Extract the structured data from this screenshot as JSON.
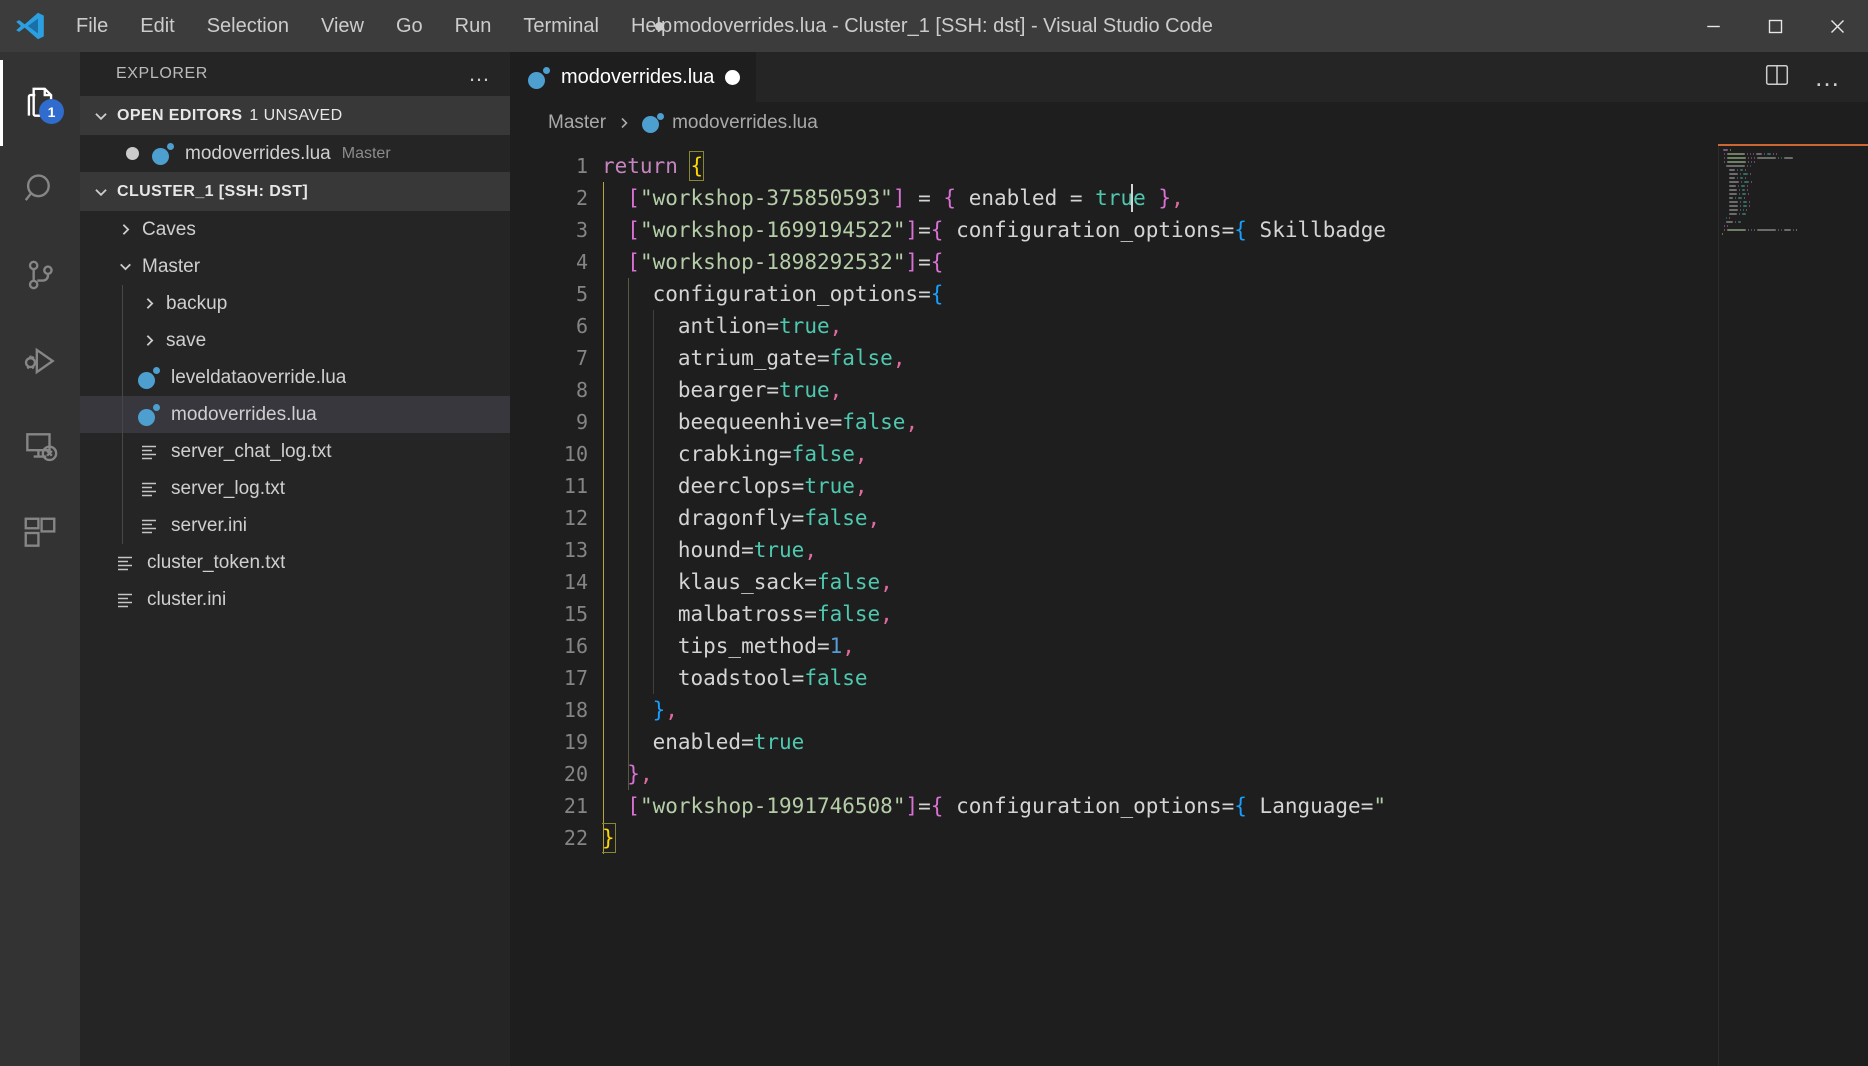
{
  "titlebar": {
    "menus": [
      "File",
      "Edit",
      "Selection",
      "View",
      "Go",
      "Run",
      "Terminal",
      "Help"
    ],
    "window_title": "modoverrides.lua - Cluster_1 [SSH: dst] - Visual Studio Code",
    "minimize_label": "Minimize",
    "maximize_label": "Maximize",
    "close_label": "Close"
  },
  "activitybar": {
    "items": [
      {
        "name": "explorer",
        "icon": "files-icon",
        "badge": "1",
        "active": true
      },
      {
        "name": "search",
        "icon": "search-icon",
        "badge": "",
        "active": false
      },
      {
        "name": "source-control",
        "icon": "source-control-icon",
        "badge": "",
        "active": false
      },
      {
        "name": "run-and-debug",
        "icon": "run-debug-icon",
        "badge": "",
        "active": false
      },
      {
        "name": "remote-explorer",
        "icon": "remote-explorer-icon",
        "badge": "",
        "active": false
      },
      {
        "name": "extensions",
        "icon": "extensions-icon",
        "badge": "",
        "active": false
      }
    ]
  },
  "sidebar": {
    "title": "EXPLORER",
    "more_actions": "…",
    "open_editors": {
      "label": "OPEN EDITORS",
      "badge": "1 UNSAVED",
      "items": [
        {
          "name": "modoverrides.lua",
          "detail": "Master",
          "icon": "lua-file-icon",
          "unsaved": true
        }
      ]
    },
    "workspace": {
      "label": "CLUSTER_1 [SSH: DST]",
      "tree": [
        {
          "name": "Caves",
          "type": "folder",
          "depth": 0,
          "expanded": false
        },
        {
          "name": "Master",
          "type": "folder",
          "depth": 0,
          "expanded": true
        },
        {
          "name": "backup",
          "type": "folder",
          "depth": 1,
          "expanded": false
        },
        {
          "name": "save",
          "type": "folder",
          "depth": 1,
          "expanded": false
        },
        {
          "name": "leveldataoverride.lua",
          "type": "lua",
          "depth": 1,
          "selected": false
        },
        {
          "name": "modoverrides.lua",
          "type": "lua",
          "depth": 1,
          "selected": true
        },
        {
          "name": "server_chat_log.txt",
          "type": "txt",
          "depth": 1,
          "selected": false
        },
        {
          "name": "server_log.txt",
          "type": "txt",
          "depth": 1,
          "selected": false
        },
        {
          "name": "server.ini",
          "type": "txt",
          "depth": 1,
          "selected": false
        },
        {
          "name": "cluster_token.txt",
          "type": "txt",
          "depth": 0,
          "selected": false
        },
        {
          "name": "cluster.ini",
          "type": "txt",
          "depth": 0,
          "selected": false
        }
      ]
    }
  },
  "editor": {
    "tab": {
      "label": "modoverrides.lua",
      "icon": "lua-file-icon",
      "dirty": true
    },
    "actions": {
      "split_editor": "split-editor-icon",
      "more": "…"
    },
    "breadcrumbs": [
      {
        "label": "Master",
        "icon": ""
      },
      {
        "label": "modoverrides.lua",
        "icon": "lua-file-icon"
      }
    ],
    "cursor_line": 2,
    "lines": [
      {
        "n": 1,
        "tokens": [
          {
            "t": "return",
            "c": "k-ret"
          },
          {
            "t": " ",
            "c": "k-plain"
          },
          {
            "t": "{",
            "c": "k-brace-y"
          }
        ]
      },
      {
        "n": 2,
        "tokens": [
          {
            "t": "  ",
            "c": "k-plain"
          },
          {
            "t": "[",
            "c": "k-brace-p"
          },
          {
            "t": "\"workshop-375850593\"",
            "c": "k-str"
          },
          {
            "t": "]",
            "c": "k-brace-p"
          },
          {
            "t": " = ",
            "c": "k-eq"
          },
          {
            "t": "{",
            "c": "k-brace-p"
          },
          {
            "t": " enabled ",
            "c": "k-plain"
          },
          {
            "t": "= ",
            "c": "k-eq"
          },
          {
            "t": "true",
            "c": "k-bool"
          },
          {
            "t": " ",
            "c": "k-plain"
          },
          {
            "t": "}",
            "c": "k-brace-p"
          },
          {
            "t": ",",
            "c": "k-brk"
          }
        ]
      },
      {
        "n": 3,
        "tokens": [
          {
            "t": "  ",
            "c": "k-plain"
          },
          {
            "t": "[",
            "c": "k-brace-p"
          },
          {
            "t": "\"workshop-1699194522\"",
            "c": "k-str"
          },
          {
            "t": "]",
            "c": "k-brace-p"
          },
          {
            "t": "=",
            "c": "k-eq"
          },
          {
            "t": "{",
            "c": "k-brace-p"
          },
          {
            "t": " configuration_options",
            "c": "k-plain"
          },
          {
            "t": "=",
            "c": "k-eq"
          },
          {
            "t": "{",
            "c": "k-brace-b"
          },
          {
            "t": " Skillbadge",
            "c": "k-plain"
          }
        ]
      },
      {
        "n": 4,
        "tokens": [
          {
            "t": "  ",
            "c": "k-plain"
          },
          {
            "t": "[",
            "c": "k-brace-p"
          },
          {
            "t": "\"workshop-1898292532\"",
            "c": "k-str"
          },
          {
            "t": "]",
            "c": "k-brace-p"
          },
          {
            "t": "=",
            "c": "k-eq"
          },
          {
            "t": "{",
            "c": "k-brace-p"
          }
        ]
      },
      {
        "n": 5,
        "tokens": [
          {
            "t": "    configuration_options",
            "c": "k-plain"
          },
          {
            "t": "=",
            "c": "k-eq"
          },
          {
            "t": "{",
            "c": "k-brace-b"
          }
        ]
      },
      {
        "n": 6,
        "tokens": [
          {
            "t": "      antlion",
            "c": "k-plain"
          },
          {
            "t": "=",
            "c": "k-eq"
          },
          {
            "t": "true",
            "c": "k-bool"
          },
          {
            "t": ",",
            "c": "k-brk"
          }
        ]
      },
      {
        "n": 7,
        "tokens": [
          {
            "t": "      atrium_gate",
            "c": "k-plain"
          },
          {
            "t": "=",
            "c": "k-eq"
          },
          {
            "t": "false",
            "c": "k-bool"
          },
          {
            "t": ",",
            "c": "k-brk"
          }
        ]
      },
      {
        "n": 8,
        "tokens": [
          {
            "t": "      bearger",
            "c": "k-plain"
          },
          {
            "t": "=",
            "c": "k-eq"
          },
          {
            "t": "true",
            "c": "k-bool"
          },
          {
            "t": ",",
            "c": "k-brk"
          }
        ]
      },
      {
        "n": 9,
        "tokens": [
          {
            "t": "      beequeenhive",
            "c": "k-plain"
          },
          {
            "t": "=",
            "c": "k-eq"
          },
          {
            "t": "false",
            "c": "k-bool"
          },
          {
            "t": ",",
            "c": "k-brk"
          }
        ]
      },
      {
        "n": 10,
        "tokens": [
          {
            "t": "      crabking",
            "c": "k-plain"
          },
          {
            "t": "=",
            "c": "k-eq"
          },
          {
            "t": "false",
            "c": "k-bool"
          },
          {
            "t": ",",
            "c": "k-brk"
          }
        ]
      },
      {
        "n": 11,
        "tokens": [
          {
            "t": "      deerclops",
            "c": "k-plain"
          },
          {
            "t": "=",
            "c": "k-eq"
          },
          {
            "t": "true",
            "c": "k-bool"
          },
          {
            "t": ",",
            "c": "k-brk"
          }
        ]
      },
      {
        "n": 12,
        "tokens": [
          {
            "t": "      dragonfly",
            "c": "k-plain"
          },
          {
            "t": "=",
            "c": "k-eq"
          },
          {
            "t": "false",
            "c": "k-bool"
          },
          {
            "t": ",",
            "c": "k-brk"
          }
        ]
      },
      {
        "n": 13,
        "tokens": [
          {
            "t": "      hound",
            "c": "k-plain"
          },
          {
            "t": "=",
            "c": "k-eq"
          },
          {
            "t": "true",
            "c": "k-bool"
          },
          {
            "t": ",",
            "c": "k-brk"
          }
        ]
      },
      {
        "n": 14,
        "tokens": [
          {
            "t": "      klaus_sack",
            "c": "k-plain"
          },
          {
            "t": "=",
            "c": "k-eq"
          },
          {
            "t": "false",
            "c": "k-bool"
          },
          {
            "t": ",",
            "c": "k-brk"
          }
        ]
      },
      {
        "n": 15,
        "tokens": [
          {
            "t": "      malbatross",
            "c": "k-plain"
          },
          {
            "t": "=",
            "c": "k-eq"
          },
          {
            "t": "false",
            "c": "k-bool"
          },
          {
            "t": ",",
            "c": "k-brk"
          }
        ]
      },
      {
        "n": 16,
        "tokens": [
          {
            "t": "      tips_method",
            "c": "k-plain"
          },
          {
            "t": "=",
            "c": "k-eq"
          },
          {
            "t": "1",
            "c": "k-num"
          },
          {
            "t": ",",
            "c": "k-brk"
          }
        ]
      },
      {
        "n": 17,
        "tokens": [
          {
            "t": "      toadstool",
            "c": "k-plain"
          },
          {
            "t": "=",
            "c": "k-eq"
          },
          {
            "t": "false",
            "c": "k-bool"
          }
        ]
      },
      {
        "n": 18,
        "tokens": [
          {
            "t": "    ",
            "c": "k-plain"
          },
          {
            "t": "}",
            "c": "k-brace-b"
          },
          {
            "t": ",",
            "c": "k-brk"
          }
        ]
      },
      {
        "n": 19,
        "tokens": [
          {
            "t": "    enabled",
            "c": "k-plain"
          },
          {
            "t": "=",
            "c": "k-eq"
          },
          {
            "t": "true",
            "c": "k-bool"
          }
        ]
      },
      {
        "n": 20,
        "tokens": [
          {
            "t": "  ",
            "c": "k-plain"
          },
          {
            "t": "}",
            "c": "k-brace-p"
          },
          {
            "t": ",",
            "c": "k-brk"
          }
        ]
      },
      {
        "n": 21,
        "tokens": [
          {
            "t": "  ",
            "c": "k-plain"
          },
          {
            "t": "[",
            "c": "k-brace-p"
          },
          {
            "t": "\"workshop-1991746508\"",
            "c": "k-str"
          },
          {
            "t": "]",
            "c": "k-brace-p"
          },
          {
            "t": "=",
            "c": "k-eq"
          },
          {
            "t": "{",
            "c": "k-brace-p"
          },
          {
            "t": " configuration_options",
            "c": "k-plain"
          },
          {
            "t": "=",
            "c": "k-eq"
          },
          {
            "t": "{",
            "c": "k-brace-b"
          },
          {
            "t": " Language",
            "c": "k-plain"
          },
          {
            "t": "=",
            "c": "k-eq"
          },
          {
            "t": "\"",
            "c": "k-str"
          }
        ]
      },
      {
        "n": 22,
        "tokens": [
          {
            "t": "}",
            "c": "k-brace-y"
          }
        ]
      }
    ]
  },
  "colors": {
    "titlebar_bg": "#3c3c3c",
    "activitybar_bg": "#333333",
    "sidebar_bg": "#252526",
    "editor_bg": "#1e1e1e",
    "accent_badge": "#2f6ccd",
    "lua_icon": "#4d9fd0",
    "selected_row": "#37373d",
    "string_green": "#b5cea8",
    "bool_teal": "#4ec9b0",
    "bracket_magenta": "#da70d6",
    "bracket_yellow": "#ffd700",
    "keyword_purple": "#c586c0"
  }
}
